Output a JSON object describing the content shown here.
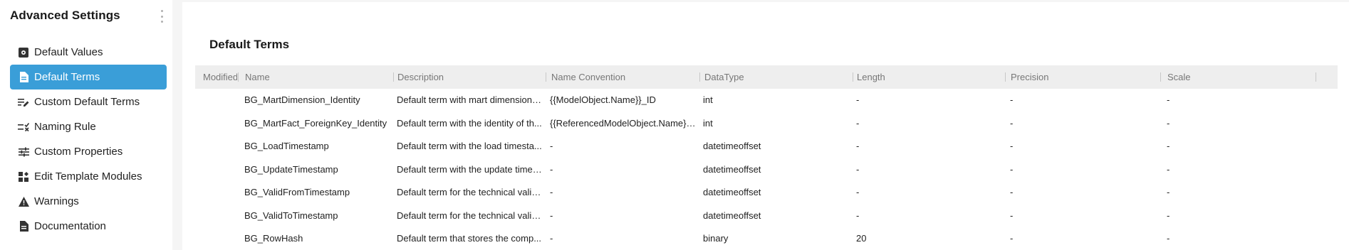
{
  "sidebar": {
    "title": "Advanced Settings",
    "items": [
      {
        "label": "Default Values",
        "icon": "settings-box-icon"
      },
      {
        "label": "Default Terms",
        "icon": "document-icon",
        "active": true
      },
      {
        "label": "Custom Default Terms",
        "icon": "edit-list-icon"
      },
      {
        "label": "Naming Rule",
        "icon": "list-check-icon"
      },
      {
        "label": "Custom Properties",
        "icon": "sliders-icon"
      },
      {
        "label": "Edit Template Modules",
        "icon": "widgets-icon"
      },
      {
        "label": "Warnings",
        "icon": "warning-icon"
      },
      {
        "label": "Documentation",
        "icon": "document-icon"
      }
    ],
    "active_color": "#3a9ed8"
  },
  "main": {
    "title": "Default Terms",
    "table": {
      "columns": [
        "Modified",
        "Name",
        "Description",
        "Name Convention",
        "DataType",
        "Length",
        "Precision",
        "Scale"
      ],
      "rows": [
        {
          "modified": "",
          "name": "BG_MartDimension_Identity",
          "description": "Default term with mart dimension i...",
          "convention": "{{ModelObject.Name}}_ID",
          "datatype": "int",
          "length": "-",
          "precision": "-",
          "scale": "-"
        },
        {
          "modified": "",
          "name": "BG_MartFact_ForeignKey_Identity",
          "description": "Default term with the identity of th...",
          "convention": "{{ReferencedModelObject.Name}}_...",
          "datatype": "int",
          "length": "-",
          "precision": "-",
          "scale": "-"
        },
        {
          "modified": "",
          "name": "BG_LoadTimestamp",
          "description": "Default term with the load timesta...",
          "convention": "-",
          "datatype": "datetimeoffset",
          "length": "-",
          "precision": "-",
          "scale": "-"
        },
        {
          "modified": "",
          "name": "BG_UpdateTimestamp",
          "description": "Default term with the update times...",
          "convention": "-",
          "datatype": "datetimeoffset",
          "length": "-",
          "precision": "-",
          "scale": "-"
        },
        {
          "modified": "",
          "name": "BG_ValidFromTimestamp",
          "description": "Default term for the technical valid...",
          "convention": "-",
          "datatype": "datetimeoffset",
          "length": "-",
          "precision": "-",
          "scale": "-"
        },
        {
          "modified": "",
          "name": "BG_ValidToTimestamp",
          "description": "Default term for the technical valid...",
          "convention": "-",
          "datatype": "datetimeoffset",
          "length": "-",
          "precision": "-",
          "scale": "-"
        },
        {
          "modified": "",
          "name": "BG_RowHash",
          "description": "Default term that stores the comp...",
          "convention": "-",
          "datatype": "binary",
          "length": "20",
          "precision": "-",
          "scale": "-"
        }
      ]
    }
  }
}
